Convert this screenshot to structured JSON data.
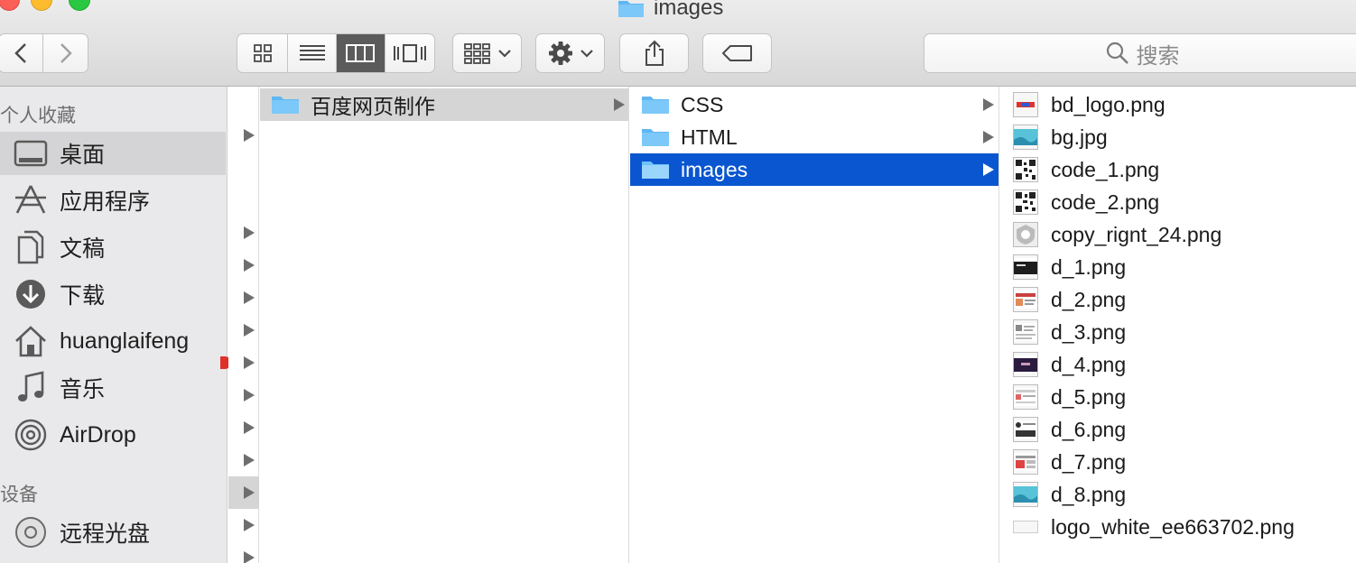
{
  "window": {
    "title": "images"
  },
  "toolbar": {
    "back_icon": "chevron-left-icon",
    "forward_icon": "chevron-right-icon",
    "view_icons": [
      "icon-view-icon",
      "list-view-icon",
      "column-view-icon",
      "cover-flow-icon"
    ],
    "active_view": "column-view-icon",
    "search_placeholder": "搜索"
  },
  "sidebar": {
    "favorites_header": "个人收藏",
    "favorites": [
      {
        "label": "桌面",
        "icon": "desktop-icon",
        "selected": true
      },
      {
        "label": "应用程序",
        "icon": "applications-icon"
      },
      {
        "label": "文稿",
        "icon": "documents-icon"
      },
      {
        "label": "下载",
        "icon": "downloads-icon"
      },
      {
        "label": "huanglaifeng",
        "icon": "home-icon"
      },
      {
        "label": "音乐",
        "icon": "music-icon"
      },
      {
        "label": "AirDrop",
        "icon": "airdrop-icon"
      }
    ],
    "devices_header": "设备",
    "devices": [
      {
        "label": "远程光盘",
        "icon": "disc-icon"
      }
    ]
  },
  "column2": {
    "items": [
      {
        "label": "百度网页制作"
      }
    ]
  },
  "column3": {
    "items": [
      {
        "label": "CSS"
      },
      {
        "label": "HTML"
      },
      {
        "label": "images"
      }
    ]
  },
  "column4": {
    "files": [
      {
        "label": "bd_logo.png"
      },
      {
        "label": "bg.jpg"
      },
      {
        "label": "code_1.png"
      },
      {
        "label": "code_2.png"
      },
      {
        "label": "copy_rignt_24.png"
      },
      {
        "label": "d_1.png"
      },
      {
        "label": "d_2.png"
      },
      {
        "label": "d_3.png"
      },
      {
        "label": "d_4.png"
      },
      {
        "label": "d_5.png"
      },
      {
        "label": "d_6.png"
      },
      {
        "label": "d_7.png"
      },
      {
        "label": "d_8.png"
      },
      {
        "label": "logo_white_ee663702.png"
      }
    ]
  },
  "colors": {
    "selection_blue": "#0a56d0",
    "folder_blue": "#5fb7f4"
  }
}
